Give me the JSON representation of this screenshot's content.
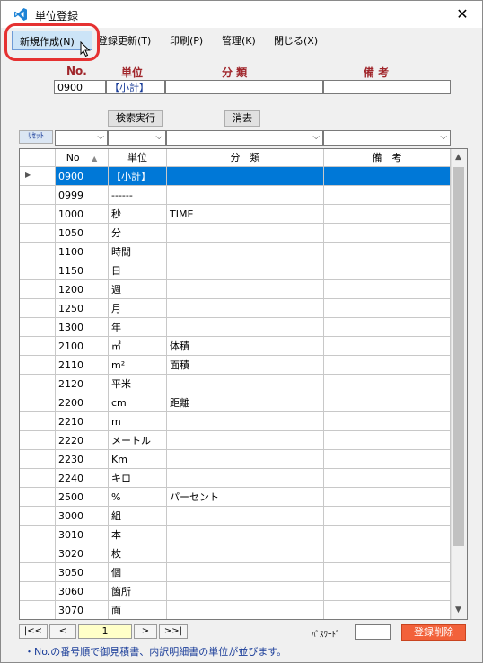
{
  "window": {
    "title": "単位登録",
    "close_glyph": "✕"
  },
  "menu": {
    "new": "新規作成(N)",
    "update": "登録更新(T)",
    "print": "印刷(P)",
    "manage": "管理(K)",
    "close": "閉じる(X)"
  },
  "headers": {
    "no": "No.",
    "unit": "単位",
    "category": "分 類",
    "remarks": "備 考"
  },
  "entry": {
    "no": "0900",
    "unit": "【小計】",
    "category": "",
    "remarks": ""
  },
  "buttons": {
    "search": "検索実行",
    "clear": "消去",
    "reset": "ﾘｾｯﾄ",
    "delete": "登録削除"
  },
  "grid": {
    "columns": {
      "no": "No",
      "unit": "単位",
      "category": "分　類",
      "remarks": "備　考"
    },
    "rows": [
      {
        "no": "0900",
        "unit": "【小計】",
        "category": "",
        "remarks": ""
      },
      {
        "no": "0999",
        "unit": "------",
        "category": "",
        "remarks": ""
      },
      {
        "no": "1000",
        "unit": "秒",
        "category": "TIME",
        "remarks": ""
      },
      {
        "no": "1050",
        "unit": "分",
        "category": "",
        "remarks": ""
      },
      {
        "no": "1100",
        "unit": "時間",
        "category": "",
        "remarks": ""
      },
      {
        "no": "1150",
        "unit": "日",
        "category": "",
        "remarks": ""
      },
      {
        "no": "1200",
        "unit": "週",
        "category": "",
        "remarks": ""
      },
      {
        "no": "1250",
        "unit": "月",
        "category": "",
        "remarks": ""
      },
      {
        "no": "1300",
        "unit": "年",
        "category": "",
        "remarks": ""
      },
      {
        "no": "2100",
        "unit": "㎥",
        "category": "体積",
        "remarks": ""
      },
      {
        "no": "2110",
        "unit": "m²",
        "category": "面積",
        "remarks": ""
      },
      {
        "no": "2120",
        "unit": "平米",
        "category": "",
        "remarks": ""
      },
      {
        "no": "2200",
        "unit": "cm",
        "category": "距離",
        "remarks": ""
      },
      {
        "no": "2210",
        "unit": "m",
        "category": "",
        "remarks": ""
      },
      {
        "no": "2220",
        "unit": "メートル",
        "category": "",
        "remarks": ""
      },
      {
        "no": "2230",
        "unit": "Km",
        "category": "",
        "remarks": ""
      },
      {
        "no": "2240",
        "unit": "キロ",
        "category": "",
        "remarks": ""
      },
      {
        "no": "2500",
        "unit": "%",
        "category": "パーセント",
        "remarks": ""
      },
      {
        "no": "3000",
        "unit": "組",
        "category": "",
        "remarks": ""
      },
      {
        "no": "3010",
        "unit": "本",
        "category": "",
        "remarks": ""
      },
      {
        "no": "3020",
        "unit": "枚",
        "category": "",
        "remarks": ""
      },
      {
        "no": "3050",
        "unit": "個",
        "category": "",
        "remarks": ""
      },
      {
        "no": "3060",
        "unit": "箇所",
        "category": "",
        "remarks": ""
      },
      {
        "no": "3070",
        "unit": "面",
        "category": "",
        "remarks": ""
      }
    ]
  },
  "pager": {
    "first": "|<<",
    "prev": "<",
    "page": "1",
    "next": ">",
    "last": ">>|"
  },
  "password_label": "ﾊﾟｽﾜｰﾄﾞ",
  "footer_note": "・No.の番号順で御見積書、内訳明細書の単位が並びます。",
  "colors": {
    "selection": "#0078d7",
    "header_red": "#a0262b",
    "delete_button": "#f2613a"
  }
}
